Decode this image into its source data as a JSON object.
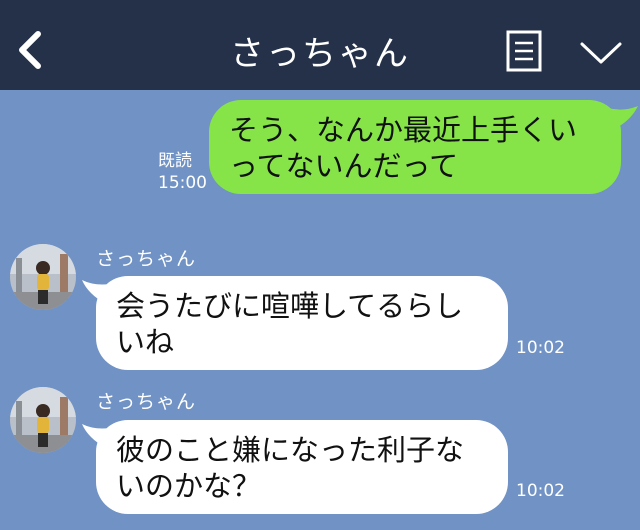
{
  "header": {
    "title": "さっちゃん",
    "back_icon": "chevron-left-icon",
    "menu_icon": "document-menu-icon",
    "expand_icon": "chevron-down-icon"
  },
  "messages": [
    {
      "direction": "sent",
      "lines": [
        "そう、なんか最近上手くい",
        "ってないんだって"
      ],
      "read_label": "既読",
      "time": "15:00"
    },
    {
      "direction": "received",
      "sender": "さっちゃん",
      "lines": [
        "会うたびに喧嘩してるらし",
        "いね"
      ],
      "time": "10:02"
    },
    {
      "direction": "received",
      "sender": "さっちゃん",
      "lines": [
        "彼のこと嫌になった利子な",
        "いのかな？"
      ],
      "time": "10:02"
    }
  ],
  "colors": {
    "header_bg": "#243149",
    "chat_bg": "#7092c4",
    "sent_bubble": "#86e449",
    "received_bubble": "#ffffff"
  }
}
